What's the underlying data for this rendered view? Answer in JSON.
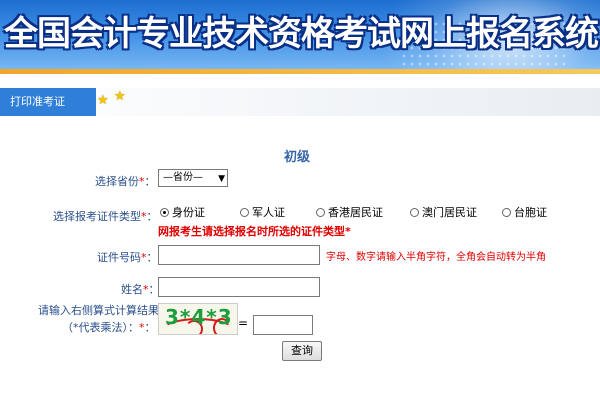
{
  "header": {
    "title": "全国会计专业技术资格考试网上报名系统"
  },
  "tabs": [
    {
      "label": "打印准考证"
    }
  ],
  "form": {
    "level_title": "初级",
    "required_mark": "*",
    "province": {
      "label": "选择省份",
      "selected": "—省份—"
    },
    "id_type": {
      "label": "选择报考证件类型",
      "options": [
        "身份证",
        "军人证",
        "香港居民证",
        "澳门居民证",
        "台胞证"
      ],
      "selected_index": 0,
      "warning": "网报考生请选择报名时所选的证件类型",
      "warning_mark": "*"
    },
    "id_number": {
      "label": "证件号码",
      "value": "",
      "hint": "字母、数字请输入半角字符，全角会自动转为半角"
    },
    "name": {
      "label": "姓名",
      "value": ""
    },
    "captcha": {
      "label_line1": "请输入右侧算式计算结果",
      "label_line2": "（*代表乘法）",
      "image_text": "3*4*3",
      "equals": "=",
      "value": ""
    },
    "submit_label": "查询"
  },
  "colors": {
    "banner": "#2f7fd9",
    "tab": "#2f7fd9",
    "label": "#2a4f8c",
    "warning": "#e00000",
    "captcha_text": "#1c9e3c"
  }
}
